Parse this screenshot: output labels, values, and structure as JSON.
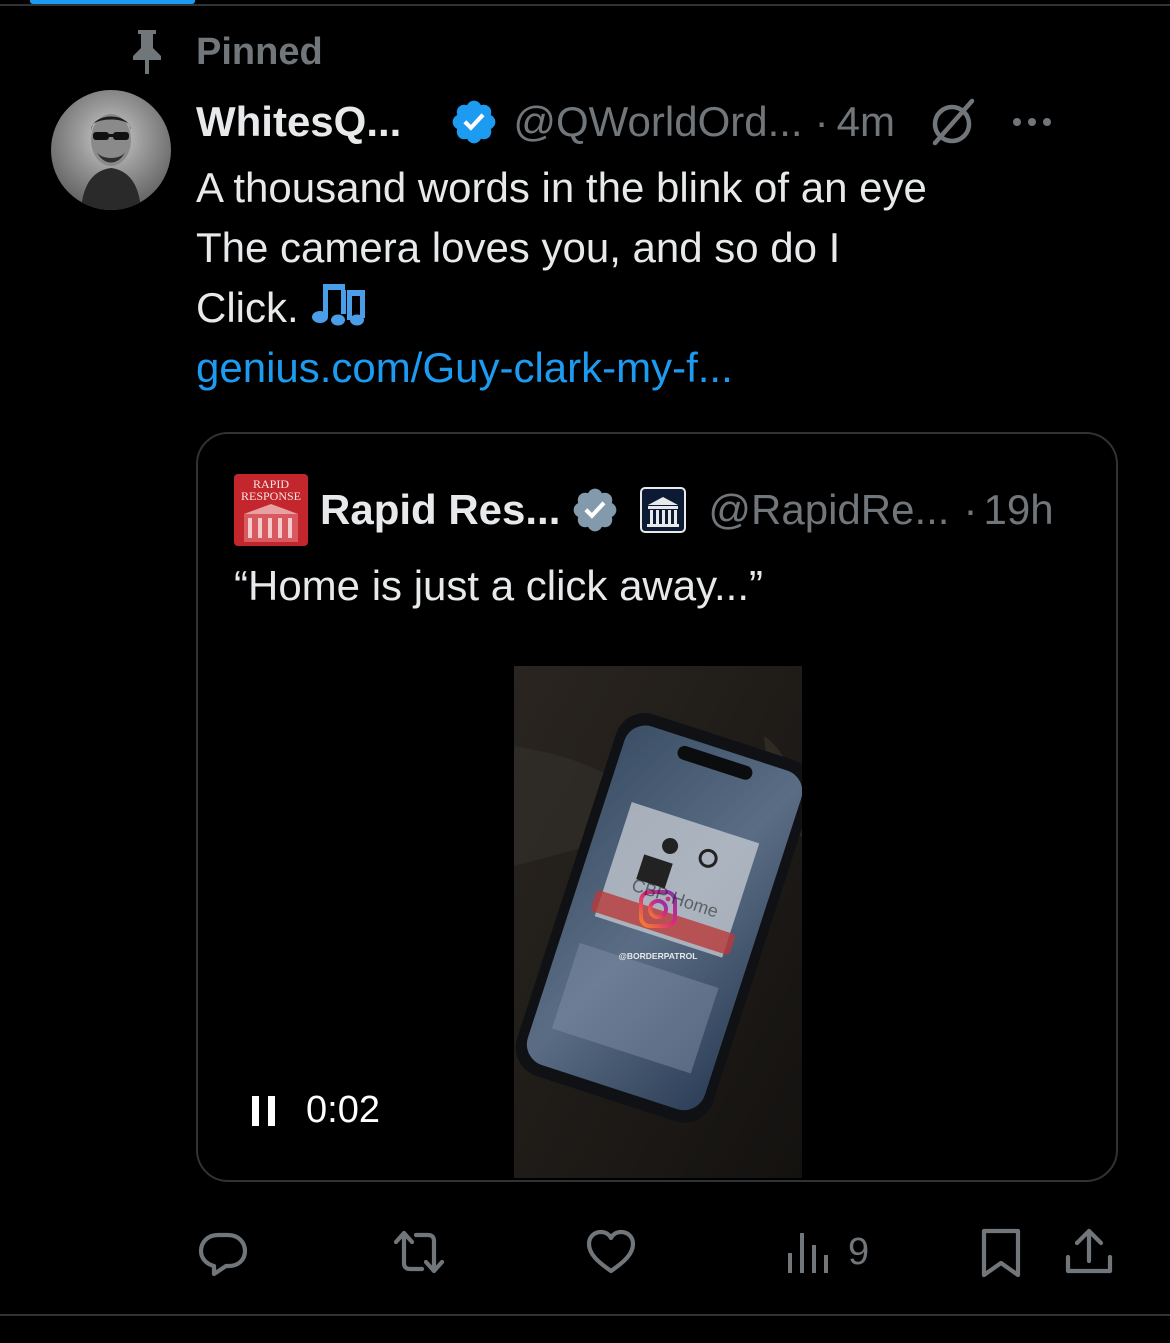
{
  "pinned": {
    "label": "Pinned",
    "icon": "pin-icon"
  },
  "author": {
    "display_name": "WhitesQ...",
    "handle": "@QWorldOrd...",
    "separator": "·",
    "time": "4m",
    "verified_icon": "verified-badge-icon",
    "grok_icon": "grok-icon",
    "more_icon": "more-icon"
  },
  "tweet": {
    "lines": [
      "A thousand words in the blink of an eye",
      "The camera loves you, and so do I",
      "Click."
    ],
    "emoji": "music-notes-icon",
    "link": "genius.com/Guy-clark-my-f..."
  },
  "quote": {
    "avatar_text_1": "RAPID",
    "avatar_text_2": "RESPONSE",
    "display_name": "Rapid Res...",
    "handle": "@RapidRe...",
    "separator": "·",
    "time": "19h",
    "text": "“Home is just a click away...”",
    "video": {
      "elapsed": "0:02",
      "overlay_text": "@BORDERPATROL",
      "screen_text": "CBP Home"
    }
  },
  "actions": {
    "reply": {
      "icon": "reply-icon"
    },
    "repost": {
      "icon": "repost-icon"
    },
    "like": {
      "icon": "like-icon"
    },
    "views": {
      "icon": "views-icon",
      "count": "9"
    },
    "bookmark": {
      "icon": "bookmark-icon"
    },
    "share": {
      "icon": "share-icon"
    }
  },
  "colors": {
    "background": "#000000",
    "text": "#e7e9ea",
    "muted": "#71767b",
    "accent": "#1d9bf0",
    "border": "#2f3336"
  }
}
